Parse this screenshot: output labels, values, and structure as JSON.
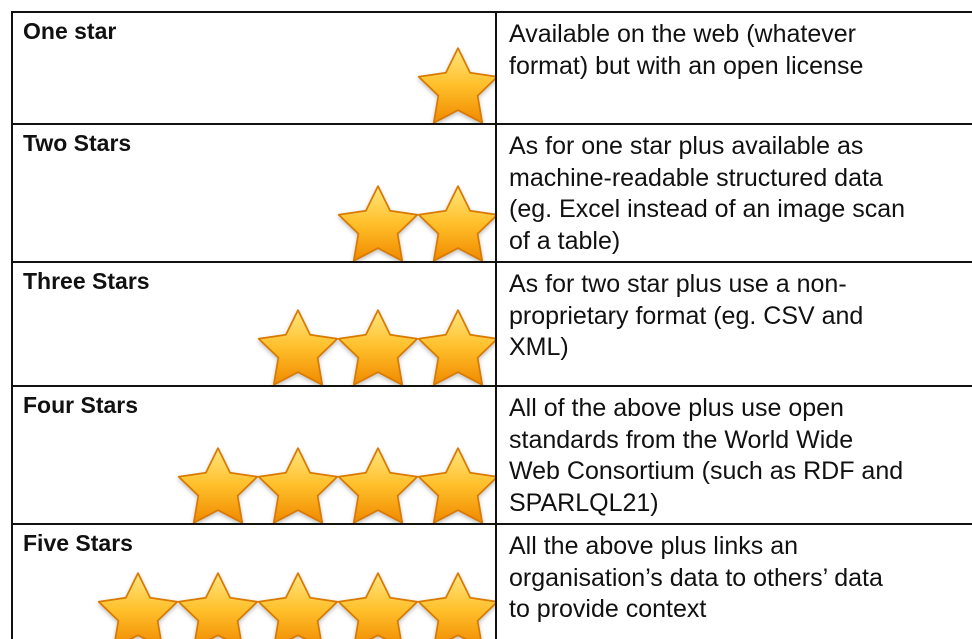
{
  "rows": [
    {
      "level": "One star",
      "stars": 1,
      "lines": [
        "Available on the web (whatever",
        "format) but with an open license"
      ]
    },
    {
      "level": "Two Stars",
      "stars": 2,
      "lines": [
        "As for one star plus available as",
        "machine-readable structured data",
        "(eg. Excel instead of an image scan",
        "of a table)"
      ]
    },
    {
      "level": "Three Stars",
      "stars": 3,
      "lines": [
        "As for two star plus use a non-",
        "proprietary format (eg. CSV and",
        "XML)"
      ]
    },
    {
      "level": "Four Stars",
      "stars": 4,
      "lines": [
        "All of the above plus use open",
        "standards from the World Wide",
        "Web Consortium (such as RDF and",
        "SPARLQL21)"
      ]
    },
    {
      "level": "Five Stars",
      "stars": 5,
      "lines": [
        "All the above plus links an",
        "organisation’s data to others’ data",
        "to provide context"
      ]
    }
  ],
  "icon": "star-icon",
  "colors": {
    "star_top": "#ffe680",
    "star_mid": "#ffbf2a",
    "star_bottom": "#f08a00",
    "star_stroke": "#d97a00",
    "border": "#111111"
  }
}
